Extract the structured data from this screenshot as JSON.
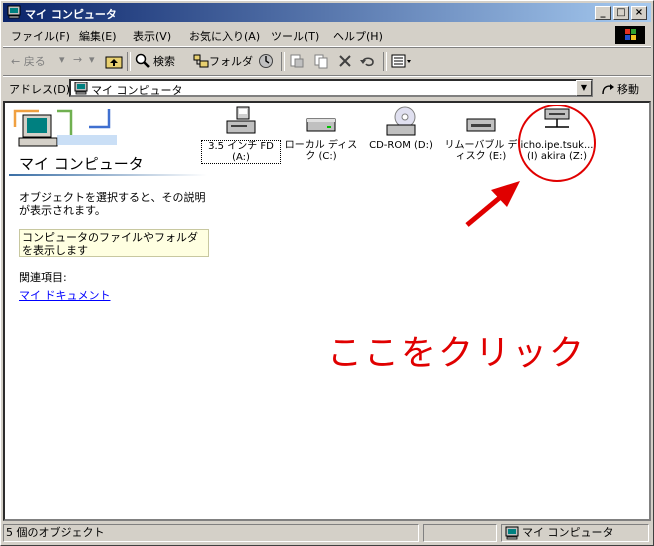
{
  "window": {
    "title": "マイ コンピュータ"
  },
  "title_buttons": {
    "min": "_",
    "max": "□",
    "close": "×"
  },
  "menu": [
    "ファイル(F)",
    "編集(E)",
    "表示(V)",
    "お気に入り(A)",
    "ツール(T)",
    "ヘルプ(H)"
  ],
  "toolbar": {
    "back": "← 戻る",
    "forward": "→",
    "search": "検索",
    "folders": "フォルダ"
  },
  "address": {
    "label": "アドレス(D)",
    "value": "マイ コンピュータ",
    "go": "移動"
  },
  "left_pane": {
    "title": "マイ コンピュータ",
    "description": "オブジェクトを選択すると、その説明が表示されます。",
    "info": "コンピュータのファイルやフォルダを表示します",
    "related_label": "関連項目:",
    "related_link": "マイ ドキュメント"
  },
  "drives": [
    {
      "label": "3.5 インチ FD (A:)",
      "icon": "floppy-drive-icon"
    },
    {
      "label": "ローカル ディスク (C:)",
      "icon": "hard-disk-icon"
    },
    {
      "label": "CD-ROM (D:)",
      "icon": "cdrom-icon"
    },
    {
      "label": "リムーバブル ディスク (E:)",
      "icon": "removable-disk-icon"
    },
    {
      "label": "icho.ipe.tsuk... (I) akira (Z:)",
      "icon": "network-drive-icon"
    }
  ],
  "annotation": {
    "text": "ここをクリック",
    "color": "#e00000"
  },
  "status": {
    "count": "5 個のオブジェクト",
    "zone": "マイ コンピュータ"
  }
}
